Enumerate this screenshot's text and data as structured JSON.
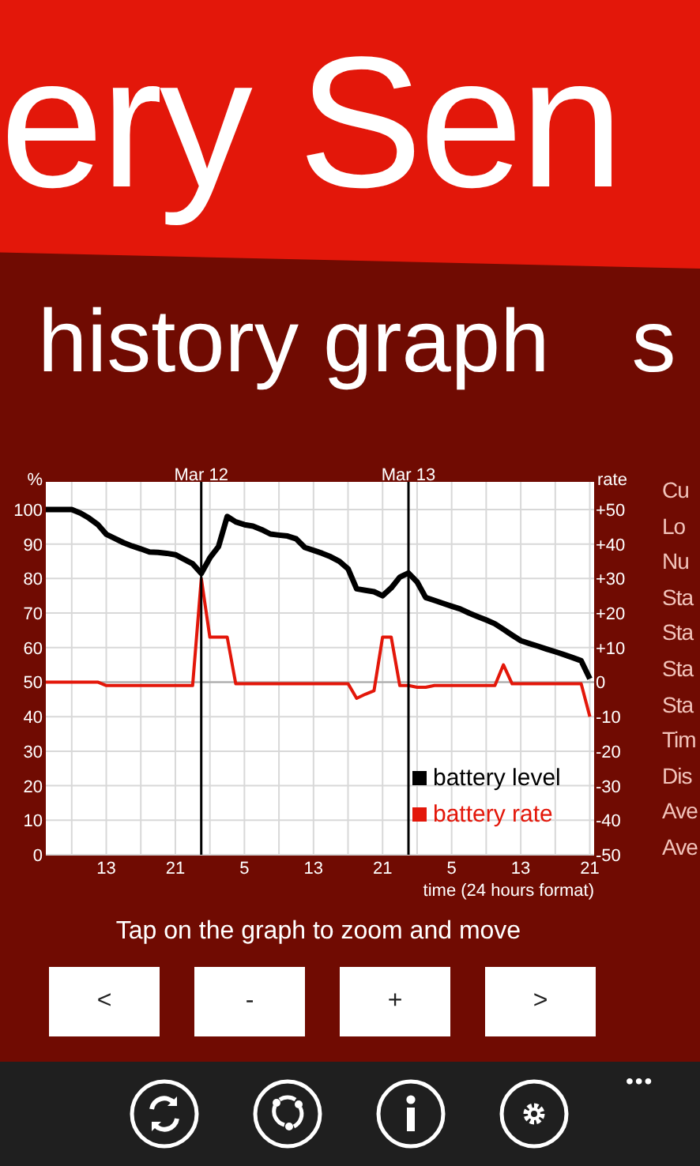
{
  "app_title": "ery Sen",
  "pivot_headers": [
    {
      "label": "history graph"
    },
    {
      "label": "s"
    }
  ],
  "chart": {
    "chart_data": {
      "type": "line",
      "xlabel": "time (24 hours format)",
      "ylabel": "%",
      "y2label": "rate",
      "categories": [
        null,
        null,
        null,
        null,
        null,
        null,
        null,
        "13",
        null,
        null,
        null,
        null,
        null,
        null,
        null,
        "21",
        null,
        null,
        null,
        null,
        null,
        null,
        null,
        "5",
        null,
        null,
        null,
        null,
        null,
        null,
        null,
        "13",
        null,
        null,
        null,
        null,
        null,
        null,
        null,
        "21",
        null,
        null,
        null,
        null,
        null,
        null,
        null,
        "5",
        null,
        null,
        null,
        null,
        null,
        null,
        null,
        "13",
        null,
        null,
        null,
        null,
        null,
        null,
        null,
        "21"
      ],
      "ylim": [
        0,
        108
      ],
      "y2lim": [
        -50,
        58
      ],
      "yticks": [
        0,
        10,
        20,
        30,
        40,
        50,
        60,
        70,
        80,
        90,
        100
      ],
      "y2ticks": [
        {
          "value": -50,
          "label": "-50"
        },
        {
          "value": -40,
          "label": "-40"
        },
        {
          "value": -30,
          "label": "-30"
        },
        {
          "value": -20,
          "label": "-20"
        },
        {
          "value": -10,
          "label": "-10"
        },
        {
          "value": 0,
          "label": "0"
        },
        {
          "value": 10,
          "label": "+10"
        },
        {
          "value": 20,
          "label": "+20"
        },
        {
          "value": 30,
          "label": "+30"
        },
        {
          "value": 40,
          "label": "+40"
        },
        {
          "value": 50,
          "label": "+50"
        }
      ],
      "annotations": [
        "Mar 12",
        "Mar 13"
      ],
      "grid": true,
      "legend": true,
      "series": [
        {
          "name": "battery level",
          "color": "#000000",
          "values": [
            100,
            100,
            100,
            100,
            99,
            97.5,
            95.7,
            92.8,
            91.6,
            90.4,
            89.4,
            88.6,
            87.7,
            87.6,
            87.3,
            86.9,
            85.6,
            84.3,
            81.5,
            86,
            89.3,
            98,
            96.4,
            95.6,
            95.2,
            94.2,
            92.9,
            92.6,
            92.3,
            91.5,
            89,
            88.2,
            87.3,
            86.3,
            85,
            82.8,
            77,
            76.6,
            76.2,
            75,
            77.3,
            80.4,
            81.6,
            79,
            74.5,
            73.7,
            72.8,
            72,
            71.2,
            70,
            69,
            68,
            66.9,
            65.3,
            63.6,
            62,
            61.2,
            60.4,
            59.6,
            58.8,
            58,
            57.1,
            56.2,
            51
          ]
        },
        {
          "name": "battery rate",
          "color": "#e3170a",
          "axis": "y2",
          "values": [
            0,
            0,
            0,
            0,
            0,
            0,
            0,
            -1,
            -1,
            -1,
            -1,
            -1,
            -1,
            -1,
            -1,
            -1,
            -1,
            -1,
            30,
            13,
            13,
            13,
            -0.5,
            -0.5,
            -0.5,
            -0.5,
            -0.5,
            -0.5,
            -0.5,
            -0.5,
            -0.5,
            -0.5,
            -0.5,
            -0.5,
            -0.5,
            -0.5,
            -4.7,
            -3.5,
            -2.5,
            13,
            13,
            -1,
            -1,
            -1.5,
            -1.5,
            -1,
            -1,
            -1,
            -1,
            -1,
            -1,
            -1,
            -1,
            5,
            -0.5,
            -0.5,
            -0.5,
            -0.5,
            -0.5,
            -0.5,
            -0.5,
            -0.5,
            -0.5,
            -10
          ]
        }
      ]
    }
  },
  "stats_labels": [
    "Cu",
    "Lo",
    "Nu",
    "Sta",
    "Sta",
    "Sta",
    "Sta",
    "Tim",
    "Dis",
    "Ave",
    "Ave"
  ],
  "hint": "Tap on the graph to zoom and move",
  "buttons": [
    "<",
    "-",
    "+",
    ">"
  ],
  "app_bar": {
    "icons": [
      {
        "kind": "refresh"
      },
      {
        "kind": "share"
      },
      {
        "kind": "info"
      },
      {
        "kind": "settings"
      }
    ],
    "more": "•••"
  }
}
